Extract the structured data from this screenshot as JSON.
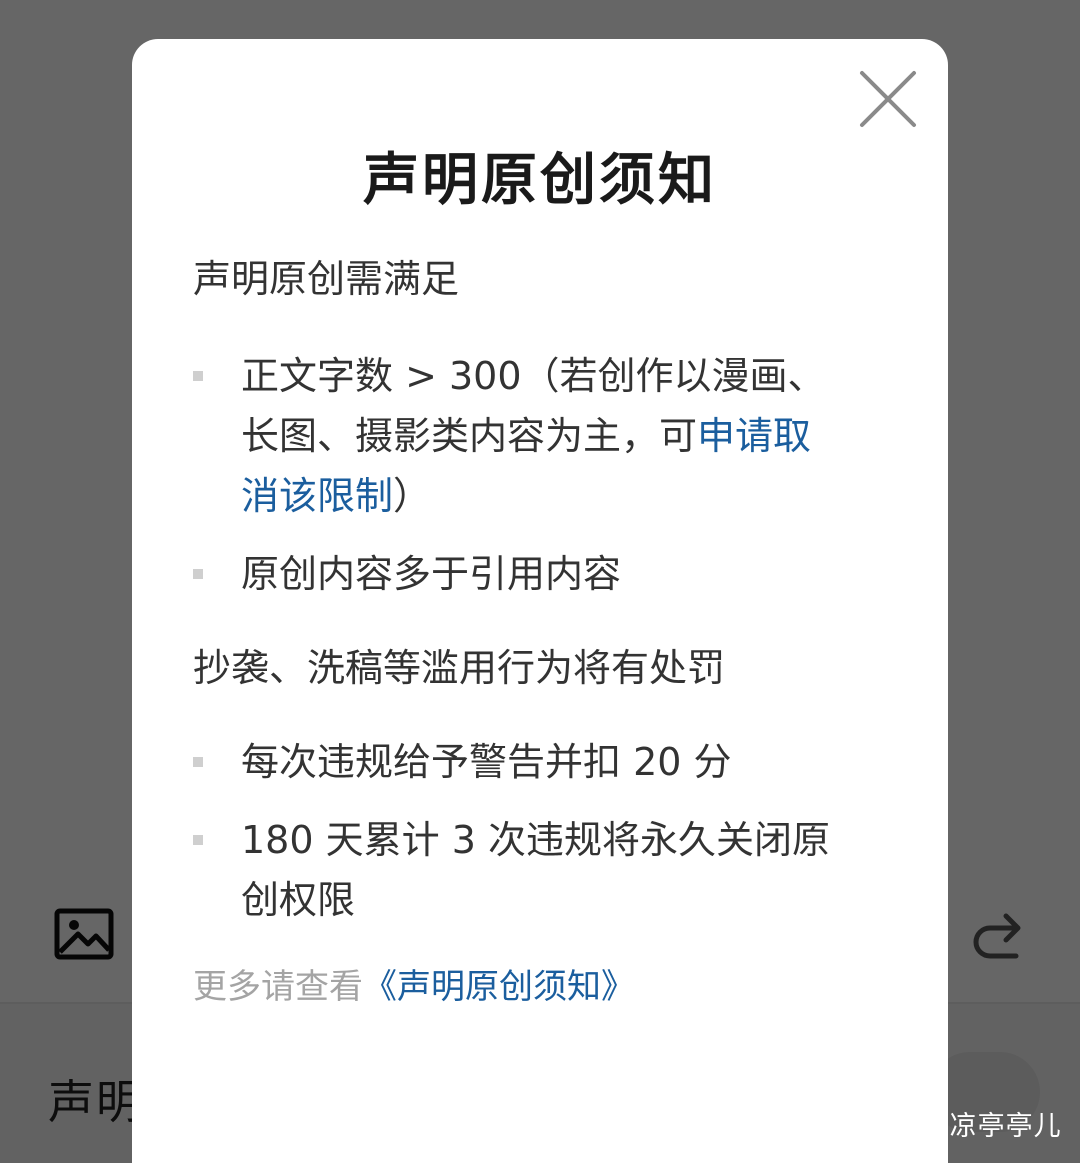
{
  "dialog": {
    "title": "声明原创须知",
    "section1": {
      "heading": "声明原创需满足",
      "item1": {
        "part1": "正文字数 > 300（若创作以漫画、",
        "part2": "长图、摄影类内容为主，可",
        "link1": "申请取",
        "link2": "消该限制",
        "suffix": "）"
      },
      "item2": "原创内容多于引用内容"
    },
    "section2": {
      "heading": "抄袭、洗稿等滥用行为将有处罚",
      "item1": "每次违规给予警告并扣 20 分",
      "item2": {
        "line1": "180 天累计 3 次违规将永久关闭原",
        "line2": "创权限"
      }
    },
    "footer": {
      "prefix": "更多请查看",
      "link": "《声明原创须知》"
    },
    "close_icon": "close-icon"
  },
  "background": {
    "bottom_label": "声明",
    "toolbar_icons": [
      "image-icon",
      "redo-icon"
    ]
  },
  "watermark": "头条 @凉亭亭儿",
  "colors": {
    "link": "#1b5e9e",
    "text": "#333333",
    "title": "#1a1a1a",
    "footer_text": "#a4a4a4",
    "overlay": "rgba(0,0,0,0.6)"
  }
}
